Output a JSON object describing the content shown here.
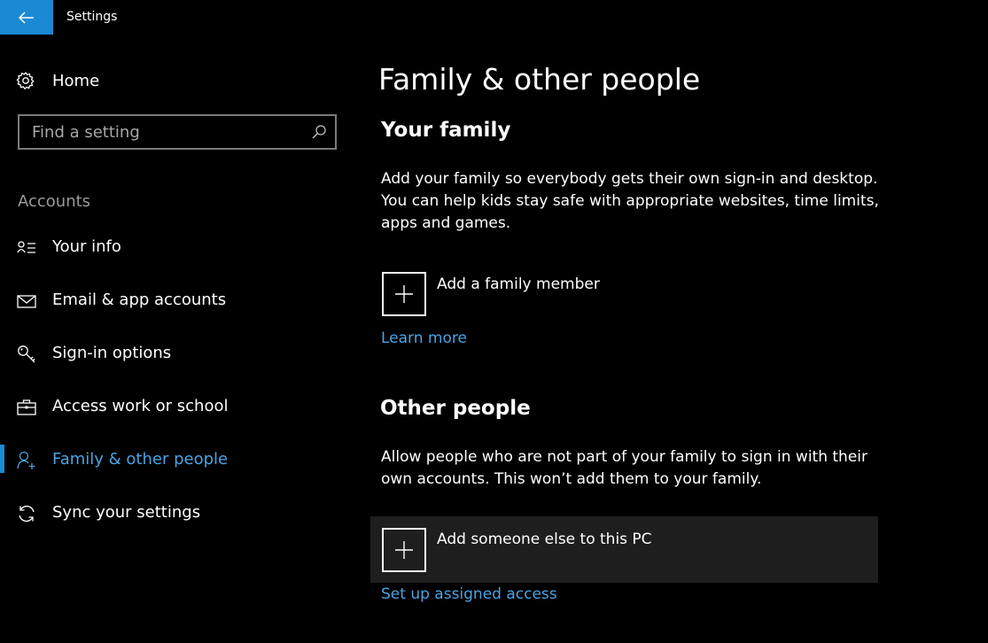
{
  "window": {
    "title": "Settings"
  },
  "sidebar": {
    "home_label": "Home",
    "search": {
      "placeholder": "Find a setting",
      "value": ""
    },
    "section_label": "Accounts",
    "items": [
      {
        "label": "Your info",
        "icon": "person-list-icon",
        "active": false
      },
      {
        "label": "Email & app accounts",
        "icon": "mail-icon",
        "active": false
      },
      {
        "label": "Sign-in options",
        "icon": "key-icon",
        "active": false
      },
      {
        "label": "Access work or school",
        "icon": "briefcase-icon",
        "active": false
      },
      {
        "label": "Family & other people",
        "icon": "person-add-icon",
        "active": true
      },
      {
        "label": "Sync your settings",
        "icon": "sync-icon",
        "active": false
      }
    ]
  },
  "main": {
    "title": "Family & other people",
    "family": {
      "heading": "Your family",
      "description": "Add your family so everybody gets their own sign-in and desktop. You can help kids stay safe with appropriate websites, time limits, apps and games.",
      "add_label": "Add a family member",
      "link": "Learn more"
    },
    "other": {
      "heading": "Other people",
      "description": "Allow people who are not part of your family to sign in with their own accounts. This won’t add them to your family.",
      "add_label": "Add someone else to this PC",
      "link": "Set up assigned access"
    }
  },
  "colors": {
    "accent": "#1a8ad4",
    "link": "#4ba3e3",
    "background": "#000000",
    "hover_row": "#1e1e1e"
  }
}
